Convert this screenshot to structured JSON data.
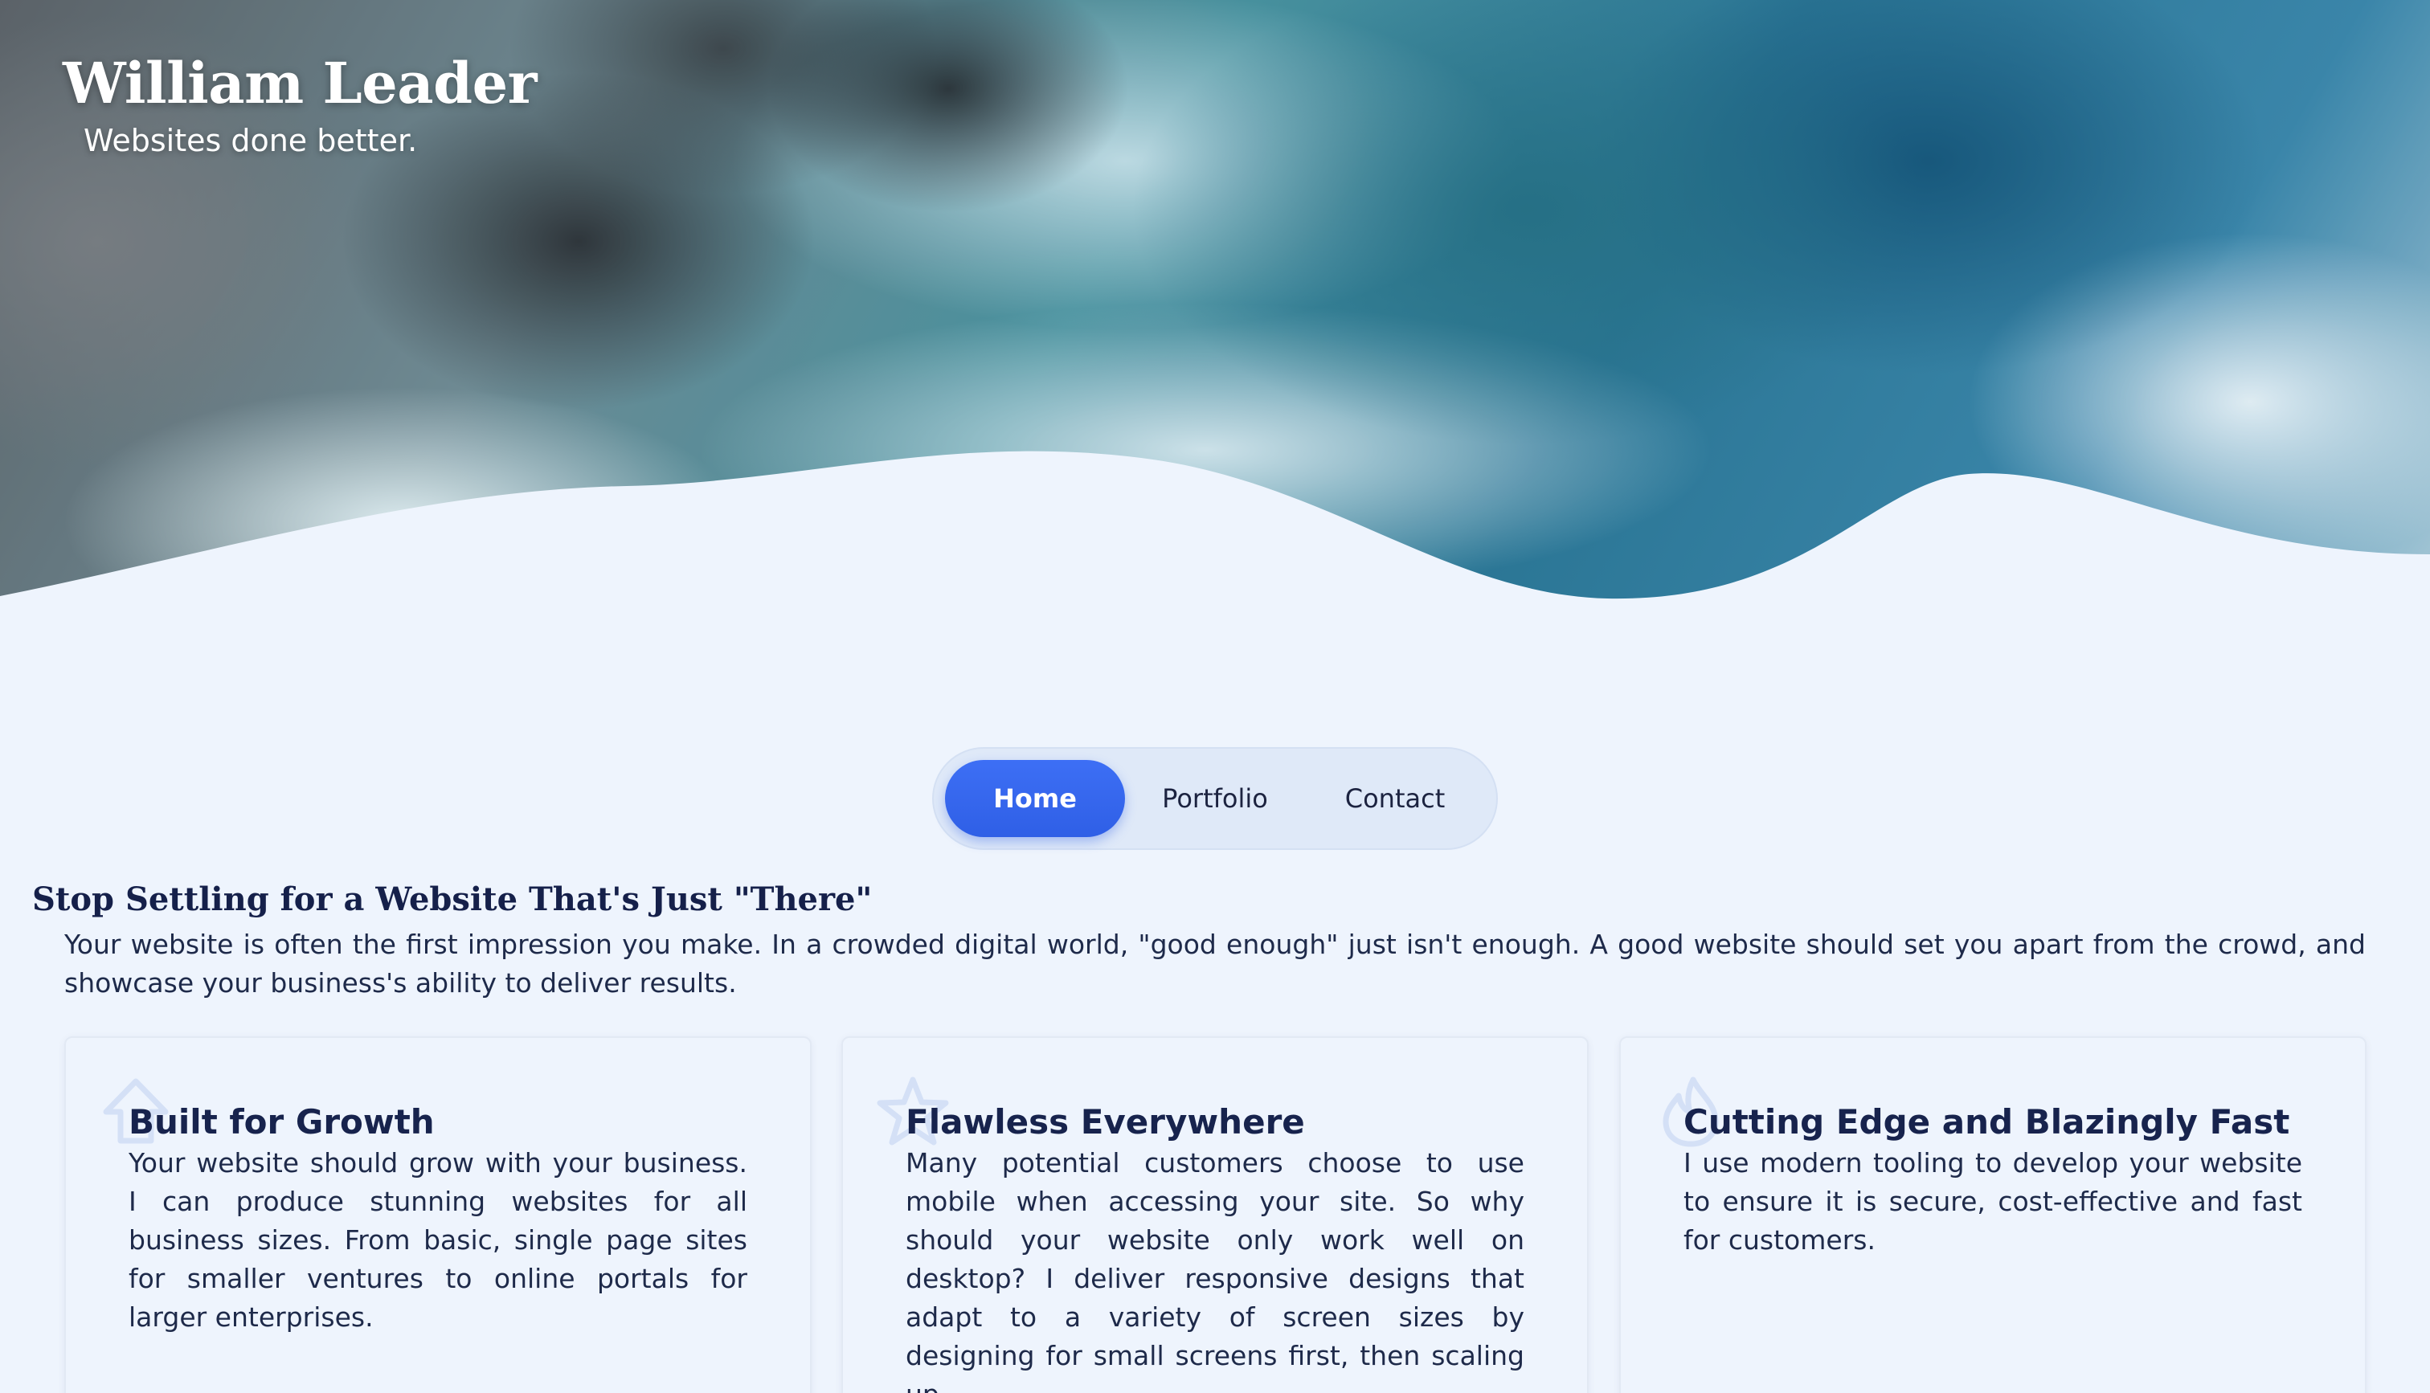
{
  "brand": {
    "title": "William Leader",
    "tagline": "Websites done better."
  },
  "nav": {
    "items": [
      {
        "label": "Home",
        "active": true
      },
      {
        "label": "Portfolio",
        "active": false
      },
      {
        "label": "Contact",
        "active": false
      }
    ]
  },
  "intro": {
    "title": "Stop Settling for a Website That's Just \"There\"",
    "text": "Your website is often the first impression you make. In a crowded digital world, \"good enough\" just isn't enough. A good website should set you apart from the crowd, and showcase your business's ability to deliver results."
  },
  "cards": [
    {
      "icon": "growth-arrow-icon",
      "title": "Built for Growth",
      "text": "Your website should grow with your business. I can produce stunning websites for all business sizes. From basic, single page sites for smaller ventures to online portals for larger enterprises."
    },
    {
      "icon": "star-icon",
      "title": "Flawless Everywhere",
      "text": "Many potential customers choose to use mobile when accessing your site. So why should your website only work well on desktop? I deliver responsive designs that adapt to a variety of screen sizes by designing for small screens first, then scaling up."
    },
    {
      "icon": "flame-icon",
      "title": "Cutting Edge and Blazingly Fast",
      "text": "I use modern tooling to develop your website to ensure it is secure, cost-effective and fast for customers."
    }
  ],
  "colors": {
    "page_background": "#eef4fd",
    "accent": "#2f5fe6",
    "heading": "#15204a",
    "nav_background": "#dfe9f8"
  }
}
